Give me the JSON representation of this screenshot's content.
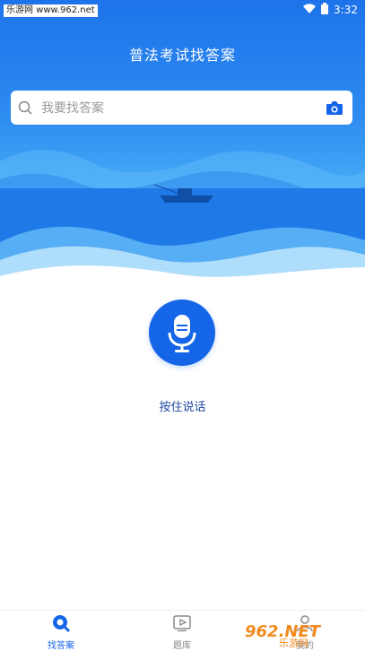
{
  "status_bar": {
    "watermark": "乐游网 www.962.net",
    "time": "3:32"
  },
  "header": {
    "title": "普法考试找答案"
  },
  "search": {
    "placeholder": "我要找答案"
  },
  "voice": {
    "hold_label": "按住说话"
  },
  "bottom_nav": {
    "tabs": [
      {
        "label": "找答案",
        "icon": "search-icon",
        "active": true
      },
      {
        "label": "题库",
        "icon": "play-box-icon",
        "active": false
      },
      {
        "label": "我的",
        "icon": "user-icon",
        "active": false
      }
    ]
  },
  "watermark_logo": {
    "text_big": "962.NET",
    "text_small": "乐游网"
  },
  "colors": {
    "accent": "#1565e8",
    "hero_top": "#1e73ea",
    "hero_bottom": "#4ab0f7"
  }
}
